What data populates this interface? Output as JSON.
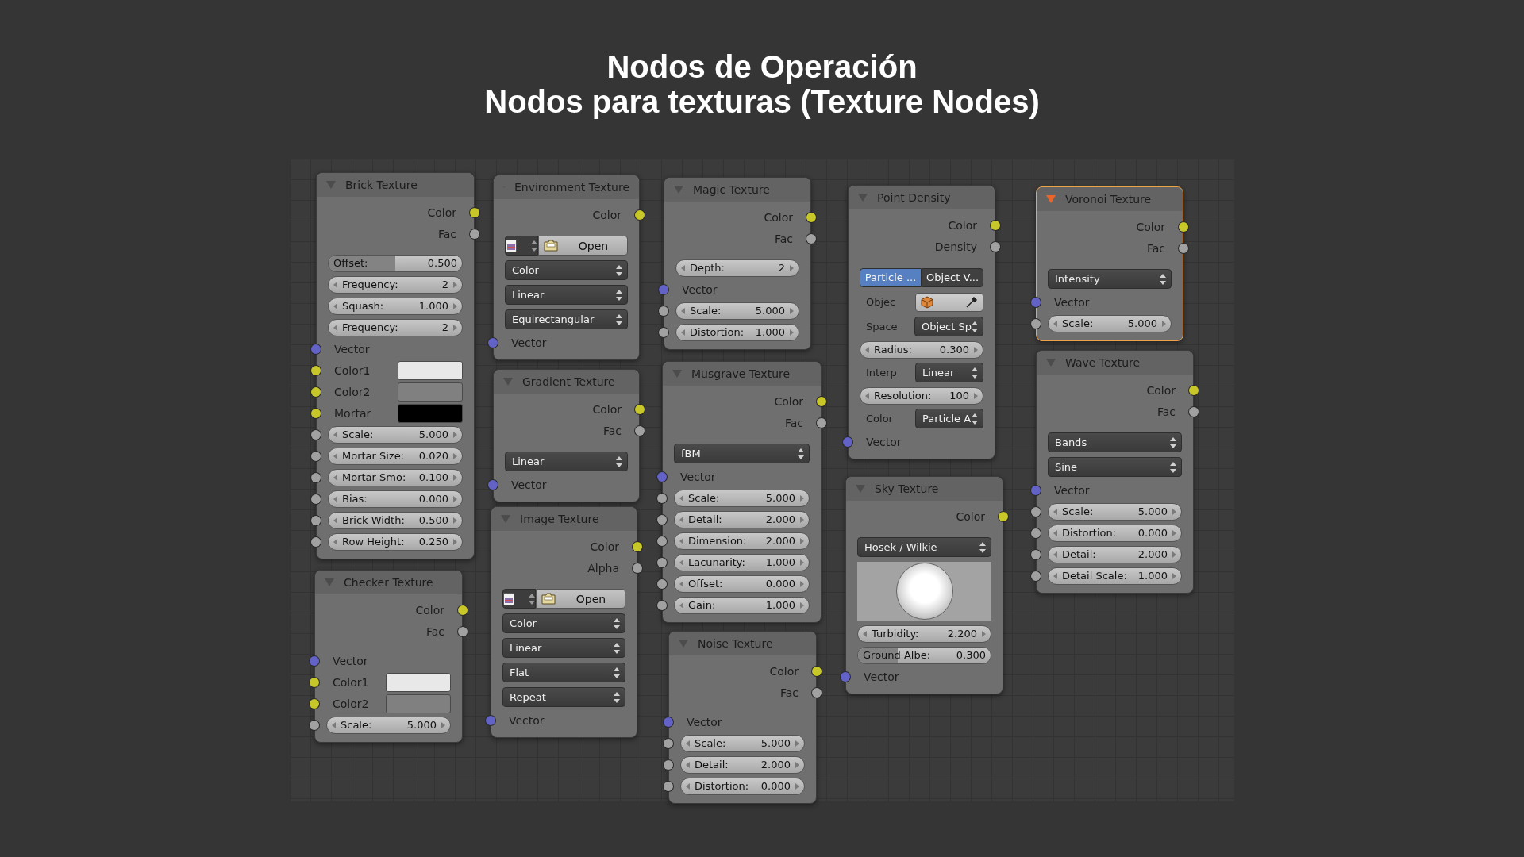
{
  "title": [
    "Nodos de Operación",
    "Nodos para texturas (Texture Nodes)"
  ],
  "nodes": [
    {
      "title": "Brick Texture",
      "selected": false,
      "rows": [
        {
          "kind": "output",
          "label": "Color",
          "color": "#c7c729"
        },
        {
          "kind": "output",
          "label": "Fac",
          "color": "#a1a1a1"
        },
        {
          "kind": "slider",
          "label": "Offset:",
          "value": "0.500",
          "level": 0.5
        },
        {
          "kind": "number",
          "label": "Frequency:",
          "value": "2"
        },
        {
          "kind": "number",
          "label": "Squash:",
          "value": "1.000"
        },
        {
          "kind": "number",
          "label": "Frequency:",
          "value": "2"
        },
        {
          "kind": "input",
          "label": "Vector",
          "color": "#6363c7"
        },
        {
          "kind": "swatch",
          "label": "Color1",
          "color": "#c7c729",
          "swatch": {
            "color": "#e8e8e8"
          }
        },
        {
          "kind": "swatch",
          "label": "Color2",
          "color": "#c7c729",
          "swatch": {
            "color": "#808080"
          }
        },
        {
          "kind": "swatch",
          "label": "Mortar",
          "color": "#c7c729",
          "swatch": {
            "color": "#000000"
          }
        },
        {
          "kind": "number",
          "label": "Scale:",
          "value": "5.000",
          "color": "#a1a1a1"
        },
        {
          "kind": "number",
          "label": "Mortar Size:",
          "value": "0.020",
          "color": "#a1a1a1"
        },
        {
          "kind": "number",
          "label": "Mortar Smo:",
          "value": "0.100",
          "color": "#a1a1a1"
        },
        {
          "kind": "number",
          "label": "Bias:",
          "value": "0.000",
          "color": "#a1a1a1"
        },
        {
          "kind": "number",
          "label": "Brick Width:",
          "value": "0.500",
          "color": "#a1a1a1"
        },
        {
          "kind": "number",
          "label": "Row Height:",
          "value": "0.250",
          "color": "#a1a1a1"
        }
      ]
    },
    {
      "title": "Checker Texture",
      "selected": false,
      "rows": [
        {
          "kind": "output",
          "label": "Color",
          "color": "#c7c729"
        },
        {
          "kind": "output",
          "label": "Fac",
          "color": "#a1a1a1"
        },
        {
          "kind": "input",
          "label": "Vector",
          "color": "#6363c7"
        },
        {
          "kind": "swatch",
          "label": "Color1",
          "color": "#c7c729",
          "swatch": {
            "color": "#e8e8e8"
          }
        },
        {
          "kind": "swatch",
          "label": "Color2",
          "color": "#c7c729",
          "swatch": {
            "color": "#808080"
          }
        },
        {
          "kind": "number",
          "label": "Scale:",
          "value": "5.000",
          "color": "#a1a1a1"
        }
      ]
    },
    {
      "title": "Environment Texture",
      "selected": false,
      "rows": [
        {
          "kind": "output",
          "label": "Color",
          "color": "#c7c729"
        },
        {
          "kind": "image",
          "button": "Open"
        },
        {
          "kind": "select",
          "value": "Color"
        },
        {
          "kind": "select",
          "value": "Linear"
        },
        {
          "kind": "select",
          "value": "Equirectangular"
        },
        {
          "kind": "input",
          "label": "Vector",
          "color": "#6363c7"
        }
      ]
    },
    {
      "title": "Gradient Texture",
      "selected": false,
      "rows": [
        {
          "kind": "output",
          "label": "Color",
          "color": "#c7c729"
        },
        {
          "kind": "output",
          "label": "Fac",
          "color": "#a1a1a1"
        },
        {
          "kind": "select",
          "value": "Linear"
        },
        {
          "kind": "input",
          "label": "Vector",
          "color": "#6363c7"
        }
      ]
    },
    {
      "title": "Image Texture",
      "selected": false,
      "rows": [
        {
          "kind": "output",
          "label": "Color",
          "color": "#c7c729"
        },
        {
          "kind": "output",
          "label": "Alpha",
          "color": "#a1a1a1"
        },
        {
          "kind": "image",
          "button": "Open"
        },
        {
          "kind": "select",
          "value": "Color"
        },
        {
          "kind": "select",
          "value": "Linear"
        },
        {
          "kind": "select",
          "value": "Flat"
        },
        {
          "kind": "select",
          "value": "Repeat"
        },
        {
          "kind": "input",
          "label": "Vector",
          "color": "#6363c7"
        }
      ]
    },
    {
      "title": "Magic Texture",
      "selected": false,
      "rows": [
        {
          "kind": "output",
          "label": "Color",
          "color": "#c7c729"
        },
        {
          "kind": "output",
          "label": "Fac",
          "color": "#a1a1a1"
        },
        {
          "kind": "number",
          "label": "Depth:",
          "value": "2"
        },
        {
          "kind": "input",
          "label": "Vector",
          "color": "#6363c7"
        },
        {
          "kind": "number",
          "label": "Scale:",
          "value": "5.000",
          "color": "#a1a1a1"
        },
        {
          "kind": "number",
          "label": "Distortion:",
          "value": "1.000",
          "color": "#a1a1a1"
        }
      ]
    },
    {
      "title": "Musgrave Texture",
      "selected": false,
      "rows": [
        {
          "kind": "output",
          "label": "Color",
          "color": "#c7c729"
        },
        {
          "kind": "output",
          "label": "Fac",
          "color": "#a1a1a1"
        },
        {
          "kind": "select",
          "value": "fBM"
        },
        {
          "kind": "input",
          "label": "Vector",
          "color": "#6363c7"
        },
        {
          "kind": "number",
          "label": "Scale:",
          "value": "5.000",
          "color": "#a1a1a1"
        },
        {
          "kind": "number",
          "label": "Detail:",
          "value": "2.000",
          "color": "#a1a1a1"
        },
        {
          "kind": "number",
          "label": "Dimension:",
          "value": "2.000",
          "color": "#a1a1a1"
        },
        {
          "kind": "number",
          "label": "Lacunarity:",
          "value": "1.000",
          "color": "#a1a1a1"
        },
        {
          "kind": "number",
          "label": "Offset:",
          "value": "0.000",
          "color": "#a1a1a1"
        },
        {
          "kind": "number",
          "label": "Gain:",
          "value": "1.000",
          "color": "#a1a1a1"
        }
      ]
    },
    {
      "title": "Noise Texture",
      "selected": false,
      "rows": [
        {
          "kind": "output",
          "label": "Color",
          "color": "#c7c729"
        },
        {
          "kind": "output",
          "label": "Fac",
          "color": "#a1a1a1"
        },
        {
          "kind": "input",
          "label": "Vector",
          "color": "#6363c7"
        },
        {
          "kind": "number",
          "label": "Scale:",
          "value": "5.000",
          "color": "#a1a1a1"
        },
        {
          "kind": "number",
          "label": "Detail:",
          "value": "2.000",
          "color": "#a1a1a1"
        },
        {
          "kind": "number",
          "label": "Distortion:",
          "value": "0.000",
          "color": "#a1a1a1"
        }
      ]
    },
    {
      "title": "Point Density",
      "selected": false,
      "rows": [
        {
          "kind": "output",
          "label": "Color",
          "color": "#c7c729"
        },
        {
          "kind": "output",
          "label": "Density",
          "color": "#a1a1a1"
        },
        {
          "kind": "tabs",
          "tabs": [
            {
              "label": "Particle ...",
              "selected": true
            },
            {
              "label": "Object V...",
              "selected": false
            }
          ]
        },
        {
          "kind": "object",
          "label": "Objec"
        },
        {
          "kind": "prop-select",
          "label": "Space",
          "value": "Object Sp"
        },
        {
          "kind": "number",
          "label": "Radius:",
          "value": "0.300"
        },
        {
          "kind": "prop-select",
          "label": "Interp",
          "value": "Linear"
        },
        {
          "kind": "number",
          "label": "Resolution:",
          "value": "100"
        },
        {
          "kind": "prop-select",
          "label": "Color",
          "value": "Particle A"
        },
        {
          "kind": "input",
          "label": "Vector",
          "color": "#6363c7"
        }
      ]
    },
    {
      "title": "Sky Texture",
      "selected": false,
      "rows": [
        {
          "kind": "output",
          "label": "Color",
          "color": "#c7c729"
        },
        {
          "kind": "select",
          "value": "Hosek / Wilkie"
        },
        {
          "kind": "preview"
        },
        {
          "kind": "number",
          "label": "Turbidity:",
          "value": "2.200"
        },
        {
          "kind": "slider",
          "label": "Ground Albe:",
          "value": "0.300",
          "level": 0.3
        },
        {
          "kind": "input",
          "label": "Vector",
          "color": "#6363c7"
        }
      ]
    },
    {
      "title": "Voronoi Texture",
      "selected": true,
      "rows": [
        {
          "kind": "output",
          "label": "Color",
          "color": "#c7c729"
        },
        {
          "kind": "output",
          "label": "Fac",
          "color": "#a1a1a1"
        },
        {
          "kind": "select",
          "value": "Intensity"
        },
        {
          "kind": "input",
          "label": "Vector",
          "color": "#6363c7"
        },
        {
          "kind": "number",
          "label": "Scale:",
          "value": "5.000",
          "color": "#a1a1a1"
        }
      ]
    },
    {
      "title": "Wave Texture",
      "selected": false,
      "rows": [
        {
          "kind": "output",
          "label": "Color",
          "color": "#c7c729"
        },
        {
          "kind": "output",
          "label": "Fac",
          "color": "#a1a1a1"
        },
        {
          "kind": "select",
          "value": "Bands"
        },
        {
          "kind": "select",
          "value": "Sine"
        },
        {
          "kind": "input",
          "label": "Vector",
          "color": "#6363c7"
        },
        {
          "kind": "number",
          "label": "Scale:",
          "value": "5.000",
          "color": "#a1a1a1"
        },
        {
          "kind": "number",
          "label": "Distortion:",
          "value": "0.000",
          "color": "#a1a1a1"
        },
        {
          "kind": "number",
          "label": "Detail:",
          "value": "2.000",
          "color": "#a1a1a1"
        },
        {
          "kind": "number",
          "label": "Detail Scale:",
          "value": "1.000",
          "color": "#a1a1a1"
        }
      ]
    }
  ]
}
